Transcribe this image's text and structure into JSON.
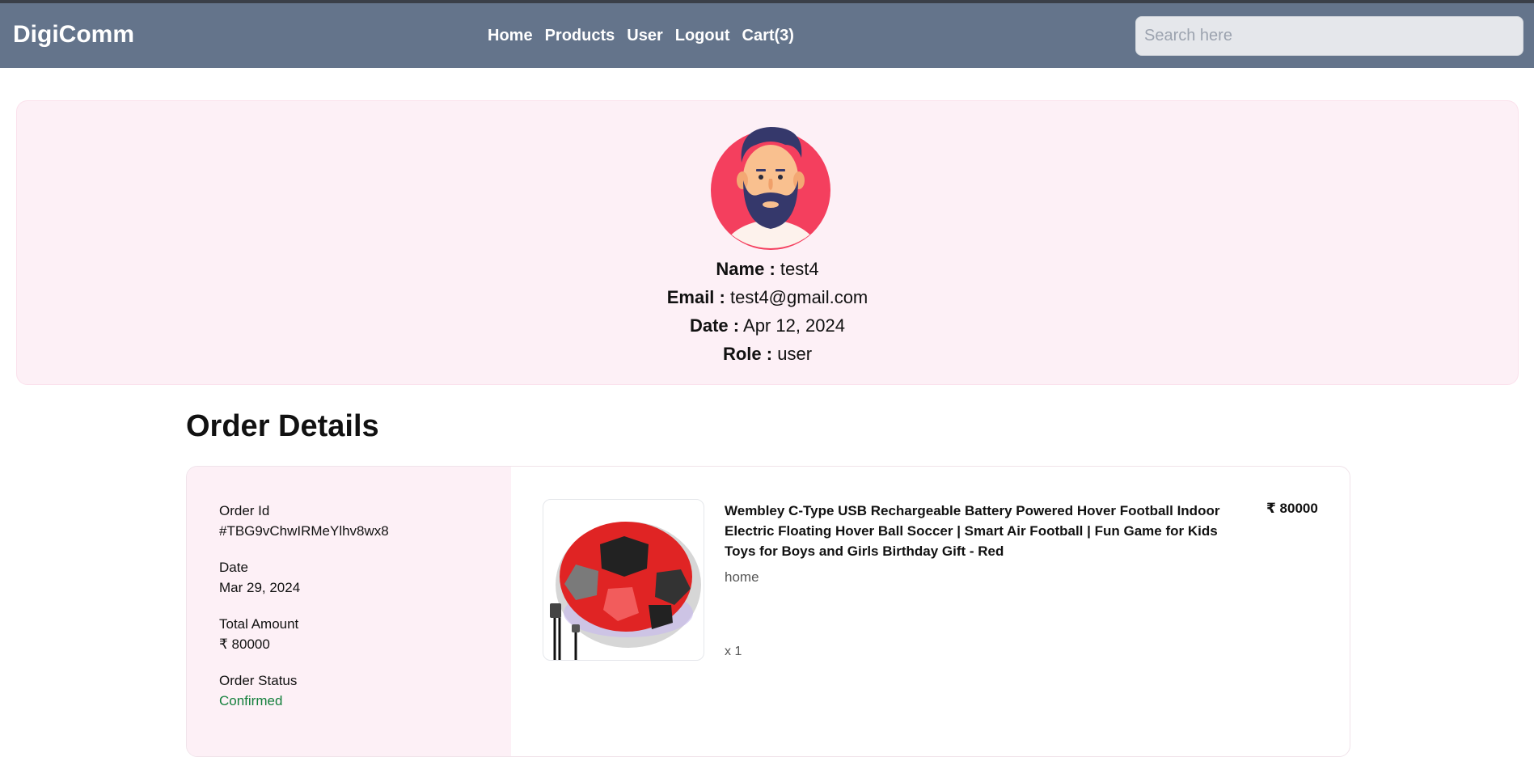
{
  "nav": {
    "brand": "DigiComm",
    "links": [
      "Home",
      "Products",
      "User",
      "Logout",
      "Cart(3)"
    ],
    "search_placeholder": "Search here"
  },
  "profile": {
    "name_label": "Name :",
    "name": "test4",
    "email_label": "Email :",
    "email": "test4@gmail.com",
    "date_label": "Date :",
    "date": "Apr 12, 2024",
    "role_label": "Role :",
    "role": "user"
  },
  "orders": {
    "heading": "Order Details",
    "order": {
      "id_label": "Order Id",
      "id": "#TBG9vChwIRMeYlhv8wx8",
      "date_label": "Date",
      "date": "Mar 29, 2024",
      "total_label": "Total Amount",
      "total": "₹ 80000",
      "status_label": "Order Status",
      "status": "Confirmed",
      "item": {
        "title": "Wembley C-Type USB Rechargeable Battery Powered Hover Football Indoor Electric Floating Hover Ball Soccer | Smart Air Football | Fun Game for Kids Toys for Boys and Girls Birthday Gift - Red",
        "price": "₹ 80000",
        "category": "home",
        "quantity": "x 1"
      }
    }
  },
  "colors": {
    "navbar": "#64748b",
    "profile_bg": "#fdf0f6",
    "status_confirmed": "#15803d",
    "avatar_bg": "#f43f5e"
  }
}
